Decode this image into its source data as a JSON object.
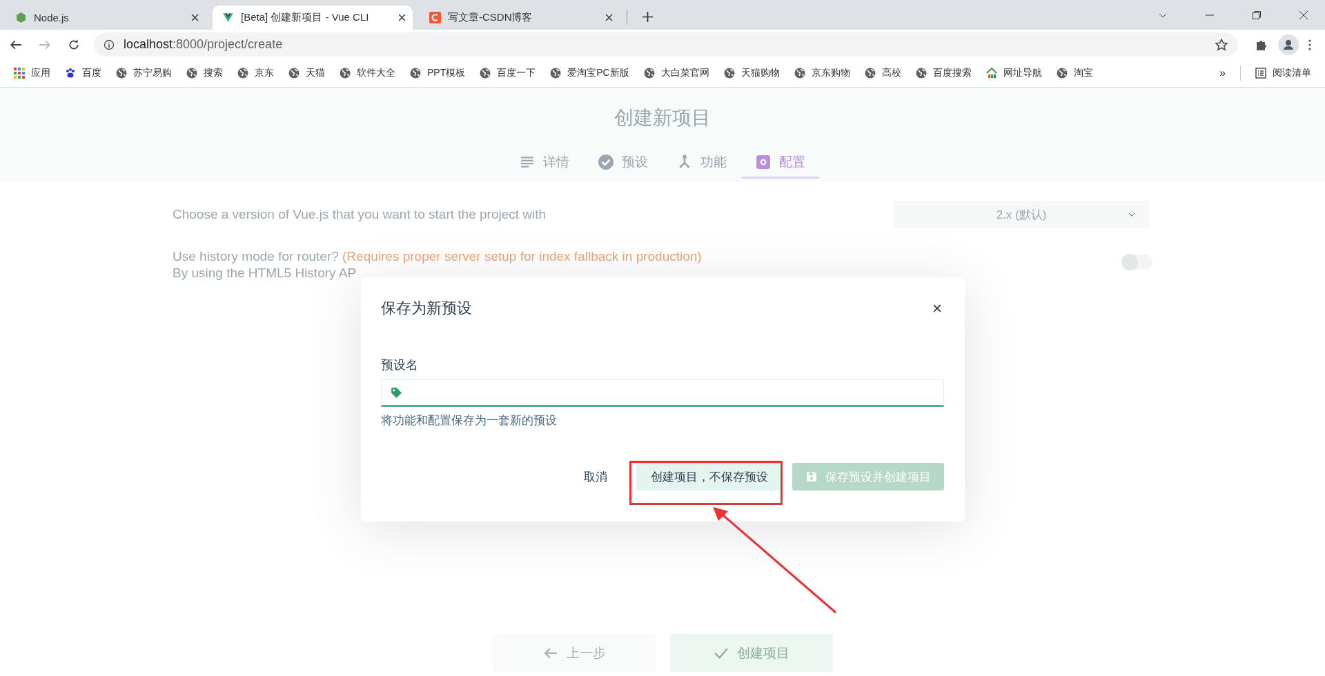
{
  "browser": {
    "tabs": [
      {
        "title": "Node.js",
        "kind": "node",
        "selected": false
      },
      {
        "title": "[Beta] 创建新项目 - Vue CLI",
        "kind": "vue",
        "selected": true
      },
      {
        "title": "写文章-CSDN博客",
        "kind": "csdn",
        "selected": false
      }
    ],
    "address": {
      "host": "localhost",
      "rest": ":8000/project/create"
    },
    "bookmarks": [
      {
        "label": "应用",
        "kind": "apps"
      },
      {
        "label": "百度",
        "kind": "paw"
      },
      {
        "label": "苏宁易购",
        "kind": "globe"
      },
      {
        "label": "搜索",
        "kind": "globe"
      },
      {
        "label": "京东",
        "kind": "globe"
      },
      {
        "label": "天猫",
        "kind": "globe"
      },
      {
        "label": "软件大全",
        "kind": "globe"
      },
      {
        "label": "PPT模板",
        "kind": "globe"
      },
      {
        "label": "百度一下",
        "kind": "globe"
      },
      {
        "label": "爱淘宝PC新版",
        "kind": "globe"
      },
      {
        "label": "大白菜官网",
        "kind": "globe"
      },
      {
        "label": "天猫购物",
        "kind": "globe"
      },
      {
        "label": "京东购物",
        "kind": "globe"
      },
      {
        "label": "高校",
        "kind": "globe"
      },
      {
        "label": "百度搜索",
        "kind": "globe"
      },
      {
        "label": "网址导航",
        "kind": "house"
      },
      {
        "label": "淘宝",
        "kind": "globe"
      }
    ],
    "overflow": "»",
    "reading_list": "阅读清单"
  },
  "page": {
    "title": "创建新项目",
    "steps": [
      {
        "label": "详情",
        "kind": "lines",
        "selected": false
      },
      {
        "label": "预设",
        "kind": "check",
        "selected": false
      },
      {
        "label": "功能",
        "kind": "fork",
        "selected": false
      },
      {
        "label": "配置",
        "kind": "gear",
        "selected": true
      }
    ],
    "options": [
      {
        "kind": "select",
        "label": "Choose a version of Vue.js that you want to start the project with",
        "value": "2.x (默认)"
      },
      {
        "kind": "toggle",
        "label": "Use history mode for router?",
        "note": "(Requires proper server setup for index fallback in production)",
        "description": "By using the HTML5 History AP",
        "on": false
      }
    ],
    "footer": {
      "back": "上一步",
      "create": "创建项目"
    }
  },
  "dialog": {
    "title": "保存为新预设",
    "field_label": "预设名",
    "hint": "将功能和配置保存为一套新的预设",
    "cancel": "取消",
    "create_without_saving": "创建项目，不保存预设",
    "save_and_create": "保存预设并创建项目"
  }
}
